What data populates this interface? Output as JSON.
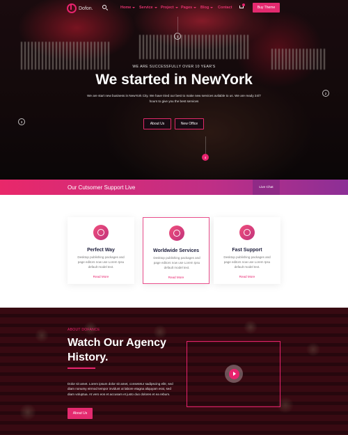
{
  "nav": {
    "logo_text": "Dofon.",
    "menu": [
      {
        "label": "Home",
        "dropdown": true
      },
      {
        "label": "Service",
        "dropdown": true
      },
      {
        "label": "Project",
        "dropdown": true
      },
      {
        "label": "Pages",
        "dropdown": true
      },
      {
        "label": "Blog",
        "dropdown": true
      },
      {
        "label": "Contact",
        "dropdown": false
      }
    ],
    "buy_button": "Buy Theme",
    "accent_color": "#e8236e"
  },
  "hero": {
    "subtitle": "WE ARE SUCCESSFULLY OVER 10 YEAR'S",
    "title": "We started in NewYork",
    "description": "We are start new business in NewYork City. We have tried our best to make new services avilable to us. We are ready 24/7 hours to give you the best services",
    "buttons": [
      "About Us",
      "New Office"
    ],
    "markers": [
      "1",
      "2",
      "3"
    ],
    "slide_indicator": "4"
  },
  "support": {
    "title": "Our Cutsomer Support Live",
    "button": "Live Chat"
  },
  "services": {
    "cards": [
      {
        "title": "Perfect Way",
        "desc": "Desktop publishing packages and page editors now use Lorem Ipsu default model text.",
        "link": "Read More",
        "icon": "lifebuoy-icon"
      },
      {
        "title": "Worldwide Services",
        "desc": "Desktop publishing packages and page editors now use Lorem Ipsu default model text.",
        "link": "Read More",
        "icon": "lifebuoy-icon"
      },
      {
        "title": "Fast Support",
        "desc": "Desktop publishing packages and page editors now use Lorem Ipsu default model text.",
        "link": "Read More",
        "icon": "lifebuoy-icon"
      }
    ]
  },
  "agency": {
    "label": "ABOUT DOFANCE",
    "title": "Watch Our Agency History.",
    "description": "Dolor sit amet. Lorem ipsum dolor sit amet, consetetur sadipscing elitr, sed diam nonumy eirmod tempor invidunt ut labore etagna aliquyam erat, sed diam voluptua. At vero eos et accusam et justo duo dolores et ea rebum.",
    "button": "About Us"
  }
}
